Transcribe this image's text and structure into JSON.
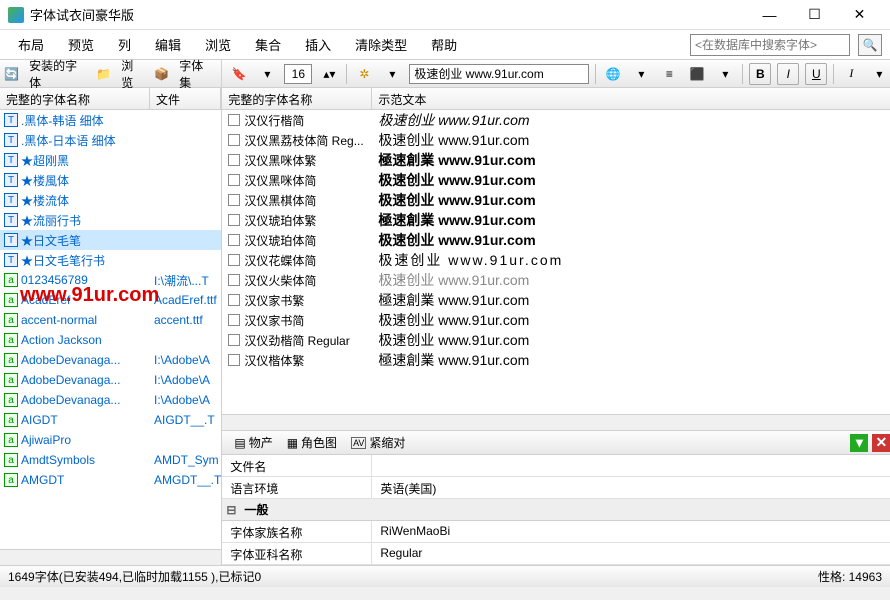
{
  "window": {
    "title": "字体试衣间豪华版"
  },
  "menu": [
    "布局",
    "预览",
    "列",
    "编辑",
    "浏览",
    "集合",
    "插入",
    "清除类型",
    "帮助"
  ],
  "search": {
    "placeholder": "<在数据库中搜索字体>"
  },
  "leftTabs": {
    "installed": "安装的字体",
    "browse": "浏览",
    "fontset": "字体集"
  },
  "leftHeader": {
    "name": "完整的字体名称",
    "file": "文件"
  },
  "leftFonts": [
    {
      "name": ".黑体-韩语 细体",
      "file": "",
      "icon": "t"
    },
    {
      "name": ".黑体-日本语 细体",
      "file": "",
      "icon": "t"
    },
    {
      "name": "★超刚黑",
      "file": "",
      "icon": "t"
    },
    {
      "name": "★楼風体",
      "file": "",
      "icon": "t"
    },
    {
      "name": "★楼流体",
      "file": "",
      "icon": "t"
    },
    {
      "name": "★流丽行书",
      "file": "",
      "icon": "t"
    },
    {
      "name": "★日文毛笔",
      "file": "",
      "icon": "t",
      "selected": true
    },
    {
      "name": "★日文毛笔行书",
      "file": "",
      "icon": "t"
    },
    {
      "name": "0123456789",
      "file": "I:\\潮流\\...T",
      "icon": "a"
    },
    {
      "name": "AcadEref",
      "file": "AcadEref.ttf",
      "icon": "a"
    },
    {
      "name": "accent-normal",
      "file": "accent.ttf",
      "icon": "a"
    },
    {
      "name": "Action Jackson",
      "file": "",
      "icon": "a"
    },
    {
      "name": "AdobeDevanaga...",
      "file": "I:\\Adobe\\A",
      "icon": "a"
    },
    {
      "name": "AdobeDevanaga...",
      "file": "I:\\Adobe\\A",
      "icon": "a"
    },
    {
      "name": "AdobeDevanaga...",
      "file": "I:\\Adobe\\A",
      "icon": "a"
    },
    {
      "name": "AIGDT",
      "file": "AIGDT__.T",
      "icon": "a"
    },
    {
      "name": "AjiwaiPro",
      "file": "",
      "icon": "a"
    },
    {
      "name": "AmdtSymbols",
      "file": "AMDT_Sym",
      "icon": "a"
    },
    {
      "name": "AMGDT",
      "file": "AMGDT__.T",
      "icon": "a"
    }
  ],
  "watermark": "www.91ur.com",
  "toolbar": {
    "size": "16",
    "sample": "极速创业 www.91ur.com",
    "bold": "B",
    "italic": "I",
    "underline": "U",
    "special": "I"
  },
  "fontHeader": {
    "name": "完整的字体名称",
    "sample": "示范文本"
  },
  "fontList": [
    {
      "name": "汉仪行楷简",
      "sample": "极速创业 www.91ur.com",
      "style": "font-style:italic"
    },
    {
      "name": "汉仪黑荔枝体简 Reg...",
      "sample": "极速创业 www.91ur.com",
      "style": ""
    },
    {
      "name": "汉仪黑咪体繁",
      "sample": "極速創業 www.91ur.com",
      "style": "font-weight:bold"
    },
    {
      "name": "汉仪黑咪体简",
      "sample": "极速创业 www.91ur.com",
      "style": "font-weight:bold"
    },
    {
      "name": "汉仪黑棋体简",
      "sample": "极速创业 www.91ur.com",
      "style": "font-weight:900"
    },
    {
      "name": "汉仪琥珀体繁",
      "sample": "極速創業 www.91ur.com",
      "style": "font-weight:bold"
    },
    {
      "name": "汉仪琥珀体简",
      "sample": "极速创业 www.91ur.com",
      "style": "font-weight:bold"
    },
    {
      "name": "汉仪花蝶体简",
      "sample": "极速创业 www.91ur.com",
      "style": "letter-spacing:2px"
    },
    {
      "name": "汉仪火柴体简",
      "sample": "极速创业 www.91ur.com",
      "style": "color:#888"
    },
    {
      "name": "汉仪家书繁",
      "sample": "極速創業 www.91ur.com",
      "style": ""
    },
    {
      "name": "汉仪家书简",
      "sample": "极速创业 www.91ur.com",
      "style": ""
    },
    {
      "name": "汉仪劲楷简 Regular",
      "sample": "极速创业 www.91ur.com",
      "style": ""
    },
    {
      "name": "汉仪楷体繁",
      "sample": "極速創業 www.91ur.com",
      "style": ""
    }
  ],
  "propsTabs": [
    "物产",
    "角色图",
    "紧缩对"
  ],
  "props": {
    "fileName": {
      "k": "文件名",
      "v": ""
    },
    "locale": {
      "k": "语言环境",
      "v": "英语(美国)"
    },
    "section": "一般",
    "family": {
      "k": "字体家族名称",
      "v": "RiWenMaoBi"
    },
    "subfamily": {
      "k": "字体亚科名称",
      "v": "Regular"
    }
  },
  "status": {
    "left": "1649字体(已安装494,已临时加载1155 ),已标记0",
    "right": "性格: 14963"
  }
}
